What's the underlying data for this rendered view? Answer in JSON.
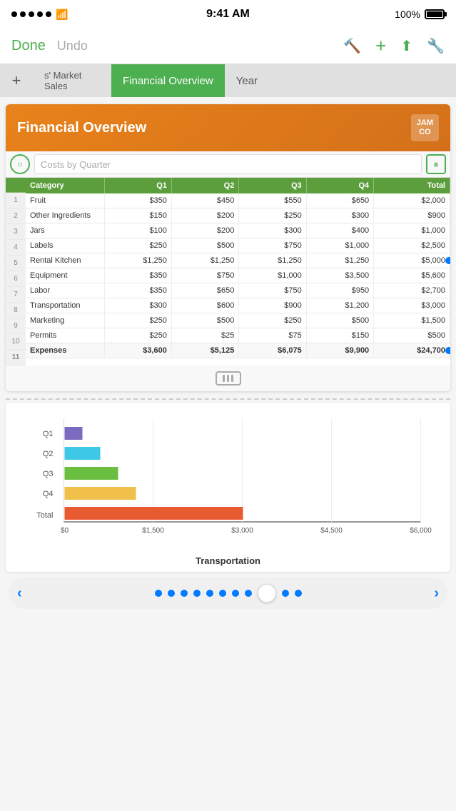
{
  "statusBar": {
    "time": "9:41 AM",
    "battery": "100%"
  },
  "toolbar": {
    "done": "Done",
    "undo": "Undo"
  },
  "tabs": {
    "addLabel": "+",
    "items": [
      {
        "label": "s' Market Sales",
        "active": false
      },
      {
        "label": "Financial Overview",
        "active": true
      },
      {
        "label": "Year",
        "active": false
      }
    ]
  },
  "sheet": {
    "title": "Financial Overview",
    "logo": "JAM\nCO",
    "formulaBar": {
      "placeholder": "Costs by Quarter"
    }
  },
  "table": {
    "headers": [
      "Category",
      "Q1",
      "Q2",
      "Q3",
      "Q4",
      "Total"
    ],
    "rows": [
      {
        "category": "Fruit",
        "q1": "$350",
        "q2": "$450",
        "q3": "$550",
        "q4": "$650",
        "total": "$2,000"
      },
      {
        "category": "Other Ingredients",
        "q1": "$150",
        "q2": "$200",
        "q3": "$250",
        "q4": "$300",
        "total": "$900"
      },
      {
        "category": "Jars",
        "q1": "$100",
        "q2": "$200",
        "q3": "$300",
        "q4": "$400",
        "total": "$1,000"
      },
      {
        "category": "Labels",
        "q1": "$250",
        "q2": "$500",
        "q3": "$750",
        "q4": "$1,000",
        "total": "$2,500"
      },
      {
        "category": "Rental Kitchen",
        "q1": "$1,250",
        "q2": "$1,250",
        "q3": "$1,250",
        "q4": "$1,250",
        "total": "$5,000"
      },
      {
        "category": "Equipment",
        "q1": "$350",
        "q2": "$750",
        "q3": "$1,000",
        "q4": "$3,500",
        "total": "$5,600"
      },
      {
        "category": "Labor",
        "q1": "$350",
        "q2": "$650",
        "q3": "$750",
        "q4": "$950",
        "total": "$2,700"
      },
      {
        "category": "Transportation",
        "q1": "$300",
        "q2": "$600",
        "q3": "$900",
        "q4": "$1,200",
        "total": "$3,000"
      },
      {
        "category": "Marketing",
        "q1": "$250",
        "q2": "$500",
        "q3": "$250",
        "q4": "$500",
        "total": "$1,500"
      },
      {
        "category": "Permits",
        "q1": "$250",
        "q2": "$25",
        "q3": "$75",
        "q4": "$150",
        "total": "$500"
      },
      {
        "category": "Expenses",
        "q1": "$3,600",
        "q2": "$5,125",
        "q3": "$6,075",
        "q4": "$9,900",
        "total": "$24,700"
      }
    ]
  },
  "chart": {
    "title": "Transportation",
    "xLabels": [
      "$0",
      "$1,500",
      "$3,000",
      "$4,500",
      "$6,000"
    ],
    "bars": [
      {
        "label": "Q1",
        "value": 300,
        "max": 6000,
        "color": "#7b6bbf"
      },
      {
        "label": "Q2",
        "value": 600,
        "max": 6000,
        "color": "#3ec8e8"
      },
      {
        "label": "Q3",
        "value": 900,
        "max": 6000,
        "color": "#6bbf40"
      },
      {
        "label": "Q4",
        "value": 1200,
        "max": 6000,
        "color": "#f0c04a"
      },
      {
        "label": "Total",
        "value": 3000,
        "max": 6000,
        "color": "#e85a30"
      }
    ]
  },
  "pagination": {
    "dots": 11,
    "activeDot": 8
  }
}
